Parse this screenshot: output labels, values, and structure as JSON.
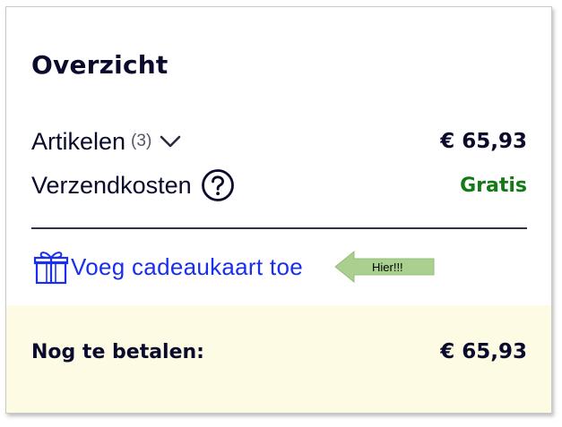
{
  "summary": {
    "title": "Overzicht",
    "items": {
      "label": "Artikelen",
      "count": "(3)",
      "amount": "€ 65,93"
    },
    "shipping": {
      "label": "Verzendkosten",
      "value": "Gratis"
    },
    "gift_card": {
      "label": "Voeg cadeaukaart toe"
    },
    "annotation": {
      "text": "Hier!!!"
    },
    "total": {
      "label": "Nog te betalen:",
      "amount": "€ 65,93"
    }
  },
  "icons": {
    "chevron": "chevron-down-icon",
    "help": "question-circle-icon",
    "gift": "gift-icon",
    "arrow": "left-arrow-callout"
  },
  "colors": {
    "text": "#0a0a2c",
    "free_shipping": "#137a15",
    "link": "#1a2ef0",
    "total_background": "#fdfbe3",
    "callout_fill": "#a9d08e"
  }
}
